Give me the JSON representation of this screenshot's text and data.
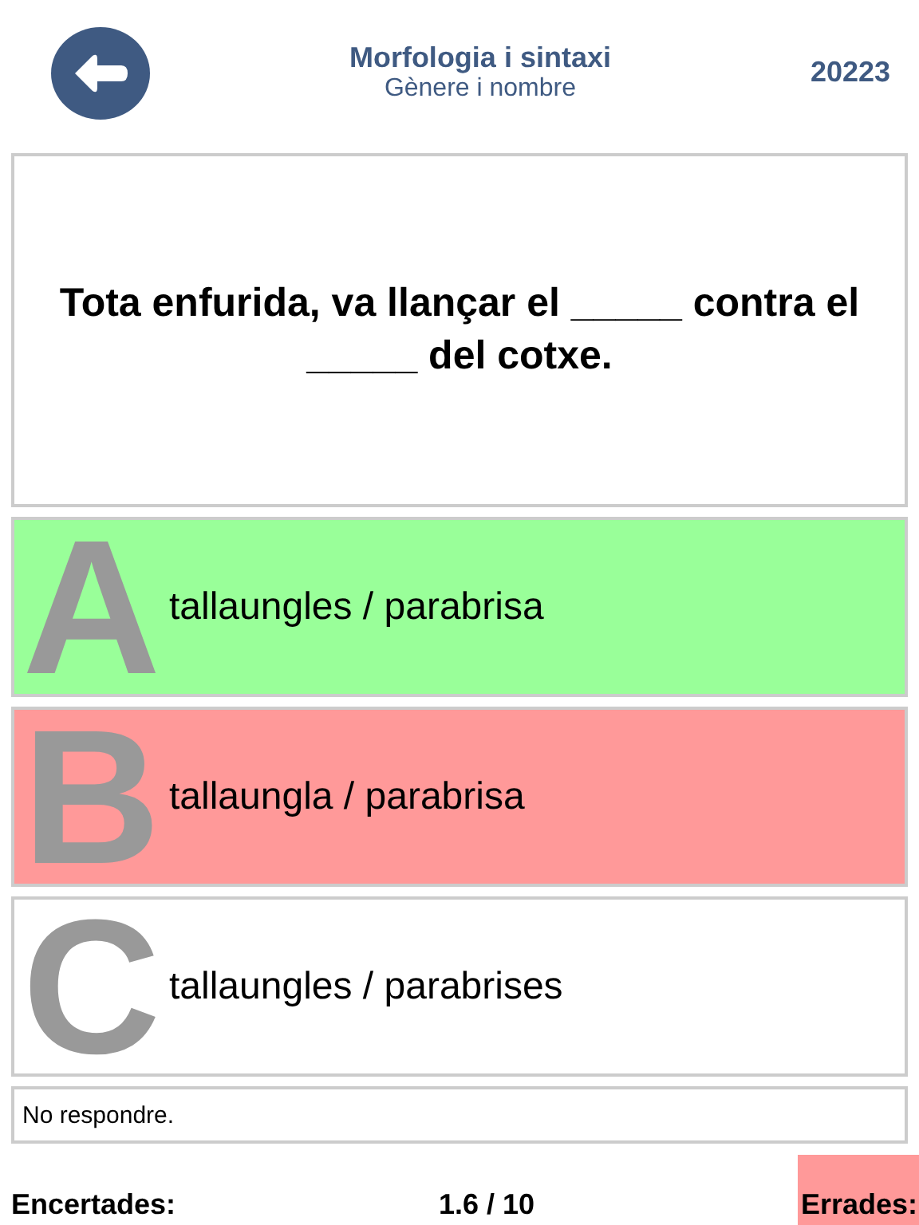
{
  "header": {
    "title": "Morfologia i sintaxi",
    "subtitle": "Gènere i nombre",
    "score_code": "20223"
  },
  "question": "Tota enfurida, va llançar el _____ contra el _____ del cotxe.",
  "options": [
    {
      "letter": "A",
      "text": "tallaungles / parabrisa",
      "kind": "correct"
    },
    {
      "letter": "B",
      "text": "tallaungla / parabrisa",
      "kind": "wrong"
    },
    {
      "letter": "C",
      "text": "tallaungles / parabrises",
      "kind": "neutral"
    }
  ],
  "skip_option": "No respondre.",
  "footer": {
    "correct_label": "Encertades:",
    "progress": "1.6 / 10",
    "wrong_label": "Errades:"
  }
}
